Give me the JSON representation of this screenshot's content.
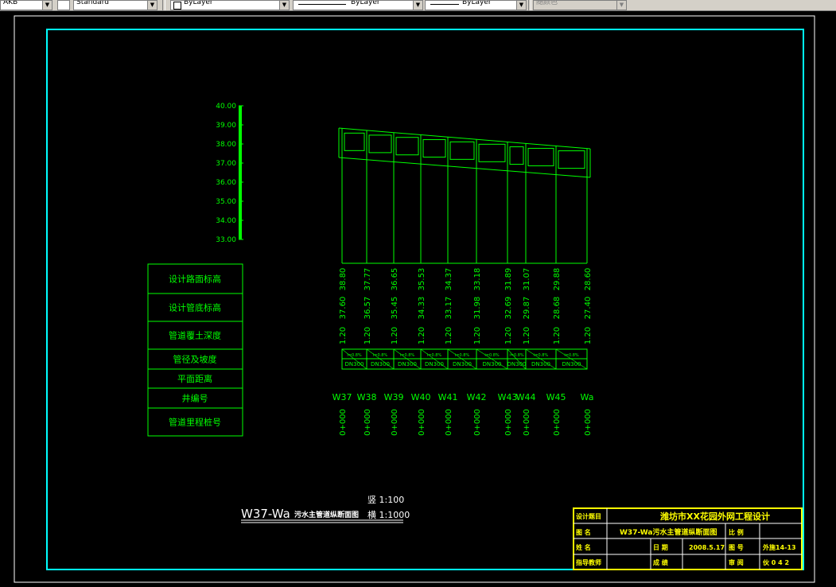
{
  "toolbar": {
    "combo1": "AKB",
    "textstyle": "Standard",
    "layer": "ByLayer",
    "linetype": "ByLayer",
    "lineweight": "ByLayer",
    "plotstyle": "随颜色"
  },
  "scale_bar": {
    "labels": [
      "40.00",
      "39.00",
      "38.00",
      "37.00",
      "36.00",
      "35.00",
      "34.00",
      "33.00"
    ]
  },
  "row_labels": [
    "设计路面标高",
    "设计管底标高",
    "管道覆土深度",
    "管径及坡度",
    "平面距离",
    "井编号",
    "管道里程桩号"
  ],
  "surface_elev": [
    "38.80",
    "37.77",
    "36.65",
    "35.53",
    "34.37",
    "33.18",
    "31.89",
    "31.07",
    "29.88",
    "28.60"
  ],
  "pipe_elev": [
    "37.60",
    "36.57",
    "35.45",
    "34.33",
    "33.17",
    "31.98",
    "32.69",
    "29.87",
    "28.68",
    "27.40"
  ],
  "cover_depth": [
    "1.20",
    "1.20",
    "1.20",
    "1.20",
    "1.20",
    "1.20",
    "1.20",
    "1.20",
    "1.20",
    "1.20"
  ],
  "pipe_spec": [
    {
      "slope": "i=0.8%",
      "dn": "DN300"
    },
    {
      "slope": "i=0.8%",
      "dn": "DN300"
    },
    {
      "slope": "i=0.8%",
      "dn": "DN300"
    },
    {
      "slope": "i=0.8%",
      "dn": "DN300"
    },
    {
      "slope": "i=0.8%",
      "dn": "DN300"
    },
    {
      "slope": "i=0.8%",
      "dn": "DN300"
    },
    {
      "slope": "i=0.8%",
      "dn": "DN300"
    },
    {
      "slope": "i=0.8%",
      "dn": "DN300"
    },
    {
      "slope": "i=0.8%",
      "dn": "DN300"
    }
  ],
  "well_ids": [
    "W37",
    "W38",
    "W39",
    "W40",
    "W41",
    "W42",
    "W43",
    "W44",
    "W45",
    "Wa"
  ],
  "stations": [
    "0+000",
    "0+000",
    "0+000",
    "0+000",
    "0+000",
    "0+000",
    "0+000",
    "0+000",
    "0+000",
    "0+000"
  ],
  "drawing_title": {
    "main": "W37-Wa",
    "sub": "污水主管道纵断面图",
    "scale_h": "竖 1:100",
    "scale_v": "横 1:1000"
  },
  "title_block": {
    "project_label": "设计题目",
    "project": "潍坊市XX花园外网工程设计",
    "name_label": "图  名",
    "name": "W37-Wa污水主管道纵断面图",
    "scale_label": "比  例",
    "author_label": "姓  名",
    "date_label": "日  期",
    "date": "2008.5.17",
    "drawing_no_label": "图  号",
    "drawing_no": "外施14-13",
    "advisor_label": "指导教师",
    "grade_label": "成  绩",
    "review_label": "审  阅",
    "review": "伙 0 4 2"
  },
  "colors": {
    "green": "#00ff00",
    "cyan": "#00ffff",
    "yellow": "#ffff00",
    "white": "#ffffff"
  }
}
